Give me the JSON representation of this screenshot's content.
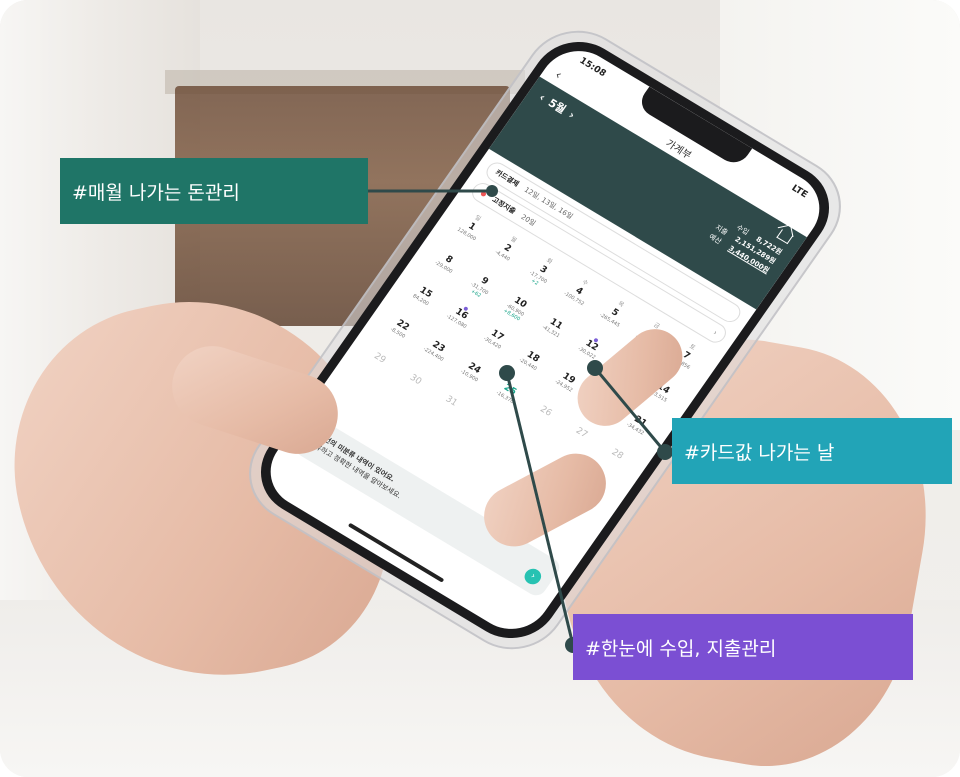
{
  "callouts": {
    "monthly": "#매월 나가는 돈관리",
    "card_day": "#카드값 나가는 날",
    "overview": "#한눈에 수입, 지출관리"
  },
  "colors": {
    "green": "#1f7567",
    "teal": "#22a4b7",
    "purple": "#7b4fd3",
    "app_header": "#2f4a4a"
  },
  "phone": {
    "status_time": "15:08",
    "status_network": "LTE",
    "nav_title": "가계부",
    "month_label": "5월",
    "summary": {
      "income_label": "수입",
      "income_value": "8,722원",
      "expense_label": "지출",
      "expense_value": "2,151,289원",
      "budget_label": "예산",
      "budget_value": "3,440,000원"
    },
    "card_payment": {
      "tag": "카드결제",
      "dates": "12일, 13일, 16일"
    },
    "fixed_expense": {
      "tag": "고정지출",
      "date": "20일"
    },
    "weekdays": [
      "일",
      "월",
      "화",
      "수",
      "목",
      "금",
      "토"
    ],
    "days": [
      {
        "n": "1",
        "amt": "128,000"
      },
      {
        "n": "2",
        "amt": "-4,440"
      },
      {
        "n": "3",
        "amt": "-17,700",
        "inc": "+2"
      },
      {
        "n": "4",
        "amt": "-100,752"
      },
      {
        "n": "5",
        "amt": "-265,445"
      },
      {
        "n": "6",
        "amt": "-165,797"
      },
      {
        "n": "7",
        "amt": "-10,856"
      },
      {
        "n": "8",
        "amt": "-29,000"
      },
      {
        "n": "9",
        "amt": "-31,700",
        "inc": "+62"
      },
      {
        "n": "10",
        "amt": "-60,900",
        "inc": "+8,600"
      },
      {
        "n": "11",
        "amt": "-41,321"
      },
      {
        "n": "12",
        "amt": "-30,022"
      },
      {
        "n": "13",
        "amt": "-28,350"
      },
      {
        "n": "14",
        "amt": "-13,515"
      },
      {
        "n": "15",
        "amt": "84,200"
      },
      {
        "n": "16",
        "amt": "-127,080"
      },
      {
        "n": "17",
        "amt": "-30,420"
      },
      {
        "n": "18",
        "amt": "-20,440"
      },
      {
        "n": "19",
        "amt": "-24,952"
      },
      {
        "n": "20",
        "amt": "-87,749"
      },
      {
        "n": "21",
        "amt": "-34,432"
      },
      {
        "n": "22",
        "amt": "-8,500"
      },
      {
        "n": "23",
        "amt": "-224,400"
      },
      {
        "n": "24",
        "amt": "-10,900"
      },
      {
        "n": "25",
        "amt": "-16,370"
      },
      {
        "n": "26",
        "amt": ""
      },
      {
        "n": "27",
        "amt": ""
      },
      {
        "n": "28",
        "amt": ""
      },
      {
        "n": "29",
        "amt": ""
      },
      {
        "n": "30",
        "amt": ""
      },
      {
        "n": "31",
        "amt": ""
      }
    ],
    "notice": {
      "title": "48건의 미분류 내역이 있어요.",
      "body": "분류하고 정확한 내역을 알아보세요."
    }
  }
}
